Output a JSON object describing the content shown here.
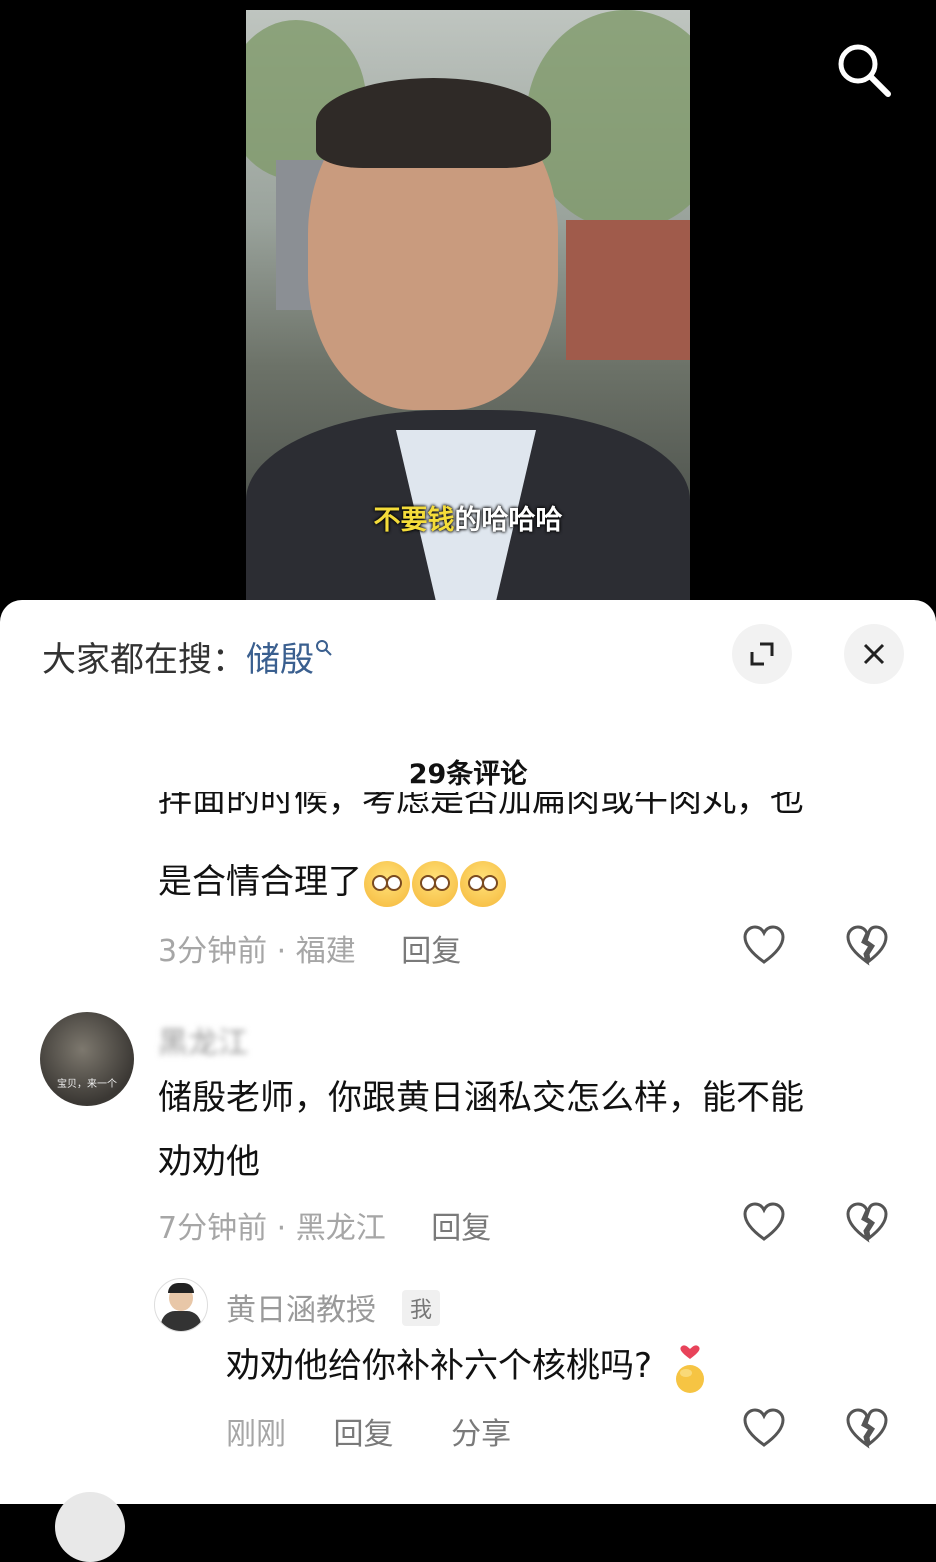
{
  "video": {
    "subtitle_highlight": "不要钱",
    "subtitle_rest": "的哈哈哈"
  },
  "icons": {
    "search": "search-icon",
    "expand": "expand-icon",
    "close": "close-icon",
    "like": "heart-icon",
    "dislike": "broken-heart-icon"
  },
  "search_hint": {
    "label": "大家都在搜：",
    "keyword": "储殷"
  },
  "comments_header": {
    "title": "29条评论"
  },
  "comments": [
    {
      "partial_line": "拌面的时候，考虑是否加扁肉或牛肉丸，也",
      "text_line": "是合情合理了",
      "time": "3分钟前",
      "location": "福建",
      "reply_label": "回复"
    },
    {
      "username": "黑龙江",
      "text_line1": "储殷老师，你跟黄日涵私交怎么样，能不能",
      "text_line2": "劝劝他",
      "time": "7分钟前",
      "location": "黑龙江",
      "reply_label": "回复",
      "avatar_caption": "宝贝，来一个"
    }
  ],
  "reply": {
    "username": "黄日涵教授",
    "badge": "我",
    "text": "劝劝他给你补补六个核桃吗?",
    "time": "刚刚",
    "reply_label": "回复",
    "share_label": "分享"
  },
  "separator": "·",
  "colors": {
    "keyword_blue": "#3a5f8f",
    "meta_gray": "#a6a6a6",
    "subtitle_yellow": "#f4dc3a"
  }
}
